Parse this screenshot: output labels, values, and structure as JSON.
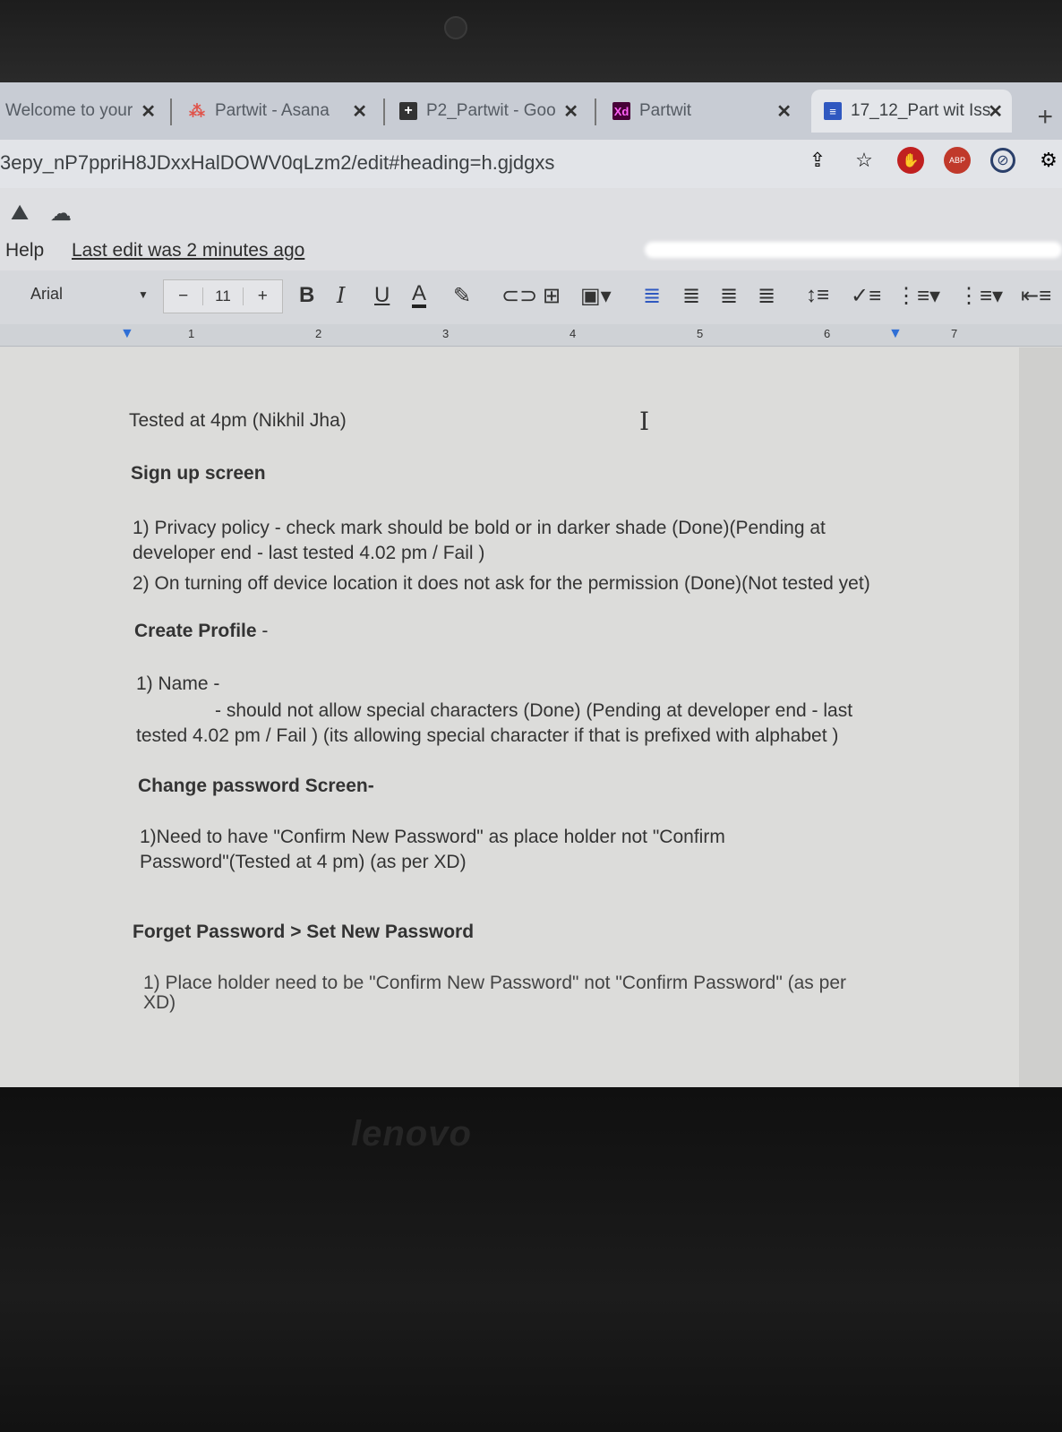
{
  "tabs": [
    {
      "title": "Welcome to your",
      "icon": "monday-icon"
    },
    {
      "title": "Partwit - Asana",
      "icon": "asana-icon"
    },
    {
      "title": "P2_Partwit - Goo",
      "icon": "sheets-icon"
    },
    {
      "title": "Partwit",
      "icon": "xd-icon",
      "icon_text": "Xd"
    },
    {
      "title": "17_12_Part wit Iss",
      "icon": "docs-icon",
      "active": true
    }
  ],
  "address": {
    "url": "3epy_nP7ppriH8JDxxHalDOWV0qLzm2/edit#heading=h.gjdgxs",
    "abp_label": "ABP"
  },
  "docs": {
    "help_menu": "Help",
    "last_edit": "Last edit was 2 minutes ago"
  },
  "toolbar": {
    "font": "Arial",
    "font_size": "11",
    "minus": "−",
    "plus": "+",
    "bold": "B",
    "italic": "I",
    "underline": "U",
    "text_color": "A"
  },
  "ruler": {
    "marks": [
      "1",
      "2",
      "3",
      "4",
      "5",
      "6",
      "7"
    ]
  },
  "content": {
    "tested": "Tested at 4pm (Nikhil Jha)",
    "signup_heading": "Sign up screen",
    "signup_1a": "1) Privacy policy - check mark should be bold or in darker shade (Done)(Pending at",
    "signup_1b": "developer end - last tested 4.02 pm / Fail )",
    "signup_2": "2) On turning off device location it does not ask for the permission (Done)(Not tested yet)",
    "profile_heading": "Create Profile",
    "profile_heading_suffix": " -",
    "profile_1": "1) Name -",
    "profile_1a": "- should not allow special characters (Done)     (Pending at developer end - last",
    "profile_1b": "tested 4.02 pm / Fail   ) (its allowing special character if that is prefixed with alphabet )",
    "change_heading": "Change password Screen-",
    "change_1a": "1)Need to have \"Confirm New Password\" as place holder not \"Confirm",
    "change_1b": "Password\"(Tested at 4 pm)  (as per XD)",
    "forget_heading": "Forget Password  > Set New Password",
    "forget_1a": "1)  Place holder need to be \"Confirm New Password\" not \"Confirm Password\"  (as per",
    "forget_1b": "XD)"
  },
  "brand": "lenovo",
  "colors": {
    "docs_blue": "#2f58c0",
    "asana_red": "#e0544b",
    "xd_brand": "#470137"
  }
}
